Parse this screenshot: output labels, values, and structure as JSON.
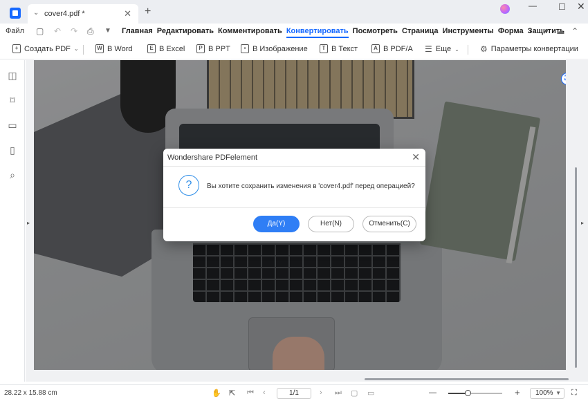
{
  "titlebar": {
    "tab_title": "cover4.pdf *",
    "tab_close": "✕",
    "tab_add": "+",
    "win_min": "—",
    "win_max": "☐",
    "win_close": "✕"
  },
  "menubar": {
    "file": "Файл",
    "items": [
      "Главная",
      "Редактировать",
      "Комментировать",
      "Конвертировать",
      "Посмотреть",
      "Страница",
      "Инструменты",
      "Форма",
      "Защитить"
    ],
    "active_index": 3,
    "more": "›"
  },
  "toolbar": {
    "create_pdf": "Создать PDF",
    "to_word": "В Word",
    "to_excel": "В Excel",
    "to_ppt": "В PPT",
    "to_image": "В Изображение",
    "to_text": "В Текст",
    "to_pdfa": "В PDF/A",
    "more": "Еще",
    "convert_settings": "Параметры конвертации"
  },
  "dialog": {
    "title": "Wondershare PDFelement",
    "close": "✕",
    "question_icon": "?",
    "message": "Вы хотите сохранить изменения в 'cover4.pdf' перед операцией?",
    "yes": "Да(Y)",
    "no": "Нет(N)",
    "cancel": "Отменить(C)"
  },
  "statusbar": {
    "page_size": "28.22 x 15.88 cm",
    "page_number": "1/1",
    "zoom_out": "—",
    "zoom_in": "+",
    "zoom_value": "100%",
    "zoom_level": 0.36
  },
  "colors": {
    "accent": "#1769ff",
    "primary_button": "#2f7ef5"
  }
}
